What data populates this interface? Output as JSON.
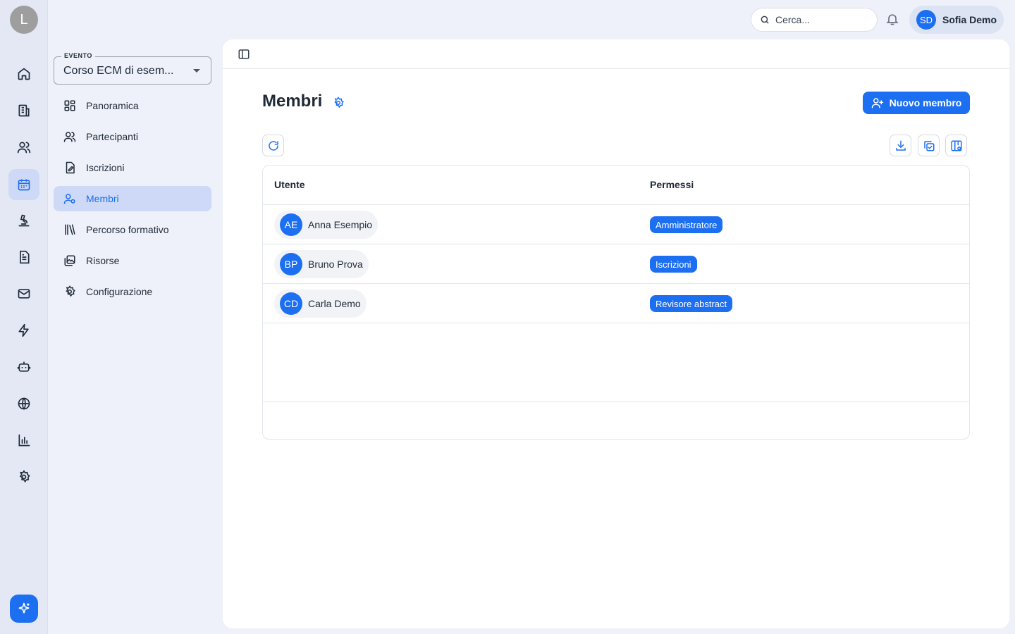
{
  "rail": {
    "avatar_initial": "L",
    "items": [
      {
        "icon": "home-icon"
      },
      {
        "icon": "building-icon"
      },
      {
        "icon": "users-icon"
      },
      {
        "icon": "calendar-icon",
        "active": true
      },
      {
        "icon": "microscope-icon"
      },
      {
        "icon": "document-icon"
      },
      {
        "icon": "mail-icon"
      },
      {
        "icon": "bolt-icon"
      },
      {
        "icon": "robot-icon"
      },
      {
        "icon": "globe-icon"
      },
      {
        "icon": "bar-chart-icon"
      },
      {
        "icon": "gear-icon"
      }
    ],
    "fab_icon": "sparkles-icon"
  },
  "topbar": {
    "search_placeholder": "Cerca...",
    "user_initials": "SD",
    "user_name": "Sofia Demo"
  },
  "sidebar": {
    "event_label": "EVENTO",
    "event_value": "Corso ECM di esem...",
    "items": [
      {
        "label": "Panoramica",
        "icon": "dashboard-icon"
      },
      {
        "label": "Partecipanti",
        "icon": "users-icon"
      },
      {
        "label": "Iscrizioni",
        "icon": "registration-icon"
      },
      {
        "label": "Membri",
        "icon": "member-icon",
        "active": true
      },
      {
        "label": "Percorso formativo",
        "icon": "library-icon"
      },
      {
        "label": "Risorse",
        "icon": "images-icon"
      },
      {
        "label": "Configurazione",
        "icon": "gear-icon"
      }
    ]
  },
  "main": {
    "title": "Membri",
    "new_button_label": "Nuovo membro",
    "table": {
      "columns": [
        "Utente",
        "Permessi"
      ],
      "rows": [
        {
          "initials": "AE",
          "name": "Anna Esempio",
          "permission": "Amministratore"
        },
        {
          "initials": "BP",
          "name": "Bruno Prova",
          "permission": "Iscrizioni"
        },
        {
          "initials": "CD",
          "name": "Carla Demo",
          "permission": "Revisore abstract"
        }
      ]
    }
  },
  "colors": {
    "accent": "#1d6ff2",
    "active_bg": "#cdd9f6",
    "background": "#eef1f9"
  }
}
